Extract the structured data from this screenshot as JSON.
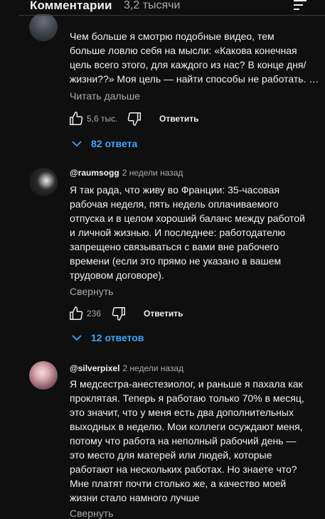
{
  "header": {
    "title": "Комментарии",
    "count": "3,2 тысячи",
    "sort_icon": "sort-icon"
  },
  "comments": [
    {
      "author": "",
      "date": "",
      "lines": [
        "Чем больше я смотрю подобные видео, тем",
        "больше ловлю себя на мысли: «Какова конечная",
        "цель всего этого, для каждого из нас? В конце дня/",
        "жизни??» Моя цель — найти способы не работать. …"
      ],
      "more_label": "Читать дальше",
      "likes": "5,6 тыс.",
      "reply_label": "Ответить",
      "replies_label": "82 ответа"
    },
    {
      "author": "@raumsogg",
      "date": "2 недели назад",
      "lines": [
        "Я так рада, что живу во Франции: 35-часовая",
        "рабочая неделя, пять недель оплачиваемого",
        "отпуска и в целом хороший баланс между работой",
        "и личной жизнью. И последнее: работодателю",
        "запрещено связываться с вами вне рабочего",
        "времени (если это прямо не указано в вашем",
        "трудовом договоре)."
      ],
      "more_label": "Свернуть",
      "likes": "236",
      "reply_label": "Ответить",
      "replies_label": "12 ответов"
    },
    {
      "author": "@silverpixel",
      "date": "2 недели назад",
      "lines": [
        "Я медсестра-анестезиолог, и раньше я пахала как",
        "проклятая. Теперь я работаю только 70% в месяц,",
        "это значит, что у меня есть два дополнительных",
        "выходных в неделю. Мои коллеги осуждают меня,",
        "потому что работа на неполный рабочий день —",
        "это место для матерей или людей, которые",
        "работают на нескольких работах. Но знаете что?",
        "Мне платят почти столько же, а качество моей",
        "жизни стало намного лучше"
      ],
      "more_label": "Свернуть"
    }
  ],
  "colors": {
    "background": "#0f0f0f",
    "text": "#f1f1f1",
    "secondary": "#aaaaaa",
    "link": "#3ea6ff"
  },
  "icons": [
    "thumb-up-icon",
    "thumb-down-icon",
    "chevron-down-icon",
    "sort-icon"
  ]
}
